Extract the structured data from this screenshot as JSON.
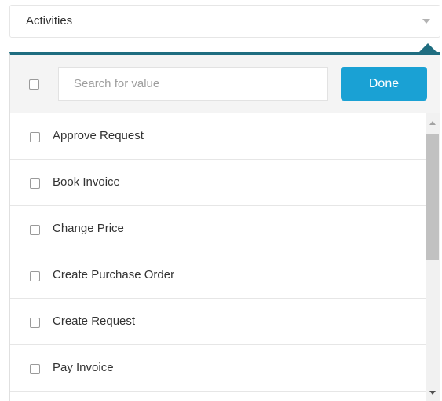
{
  "field": {
    "value": "Activities",
    "caret_icon": "caret-down-icon"
  },
  "popup": {
    "accent_color": "#1f6d80",
    "search": {
      "placeholder": "Search for value",
      "value": ""
    },
    "done_label": "Done",
    "done_color": "#1aa1d4",
    "items": [
      {
        "label": "Approve Request",
        "checked": false
      },
      {
        "label": "Book Invoice",
        "checked": false
      },
      {
        "label": "Change Price",
        "checked": false
      },
      {
        "label": "Create Purchase Order",
        "checked": false
      },
      {
        "label": "Create Request",
        "checked": false
      },
      {
        "label": "Pay Invoice",
        "checked": false
      }
    ]
  }
}
